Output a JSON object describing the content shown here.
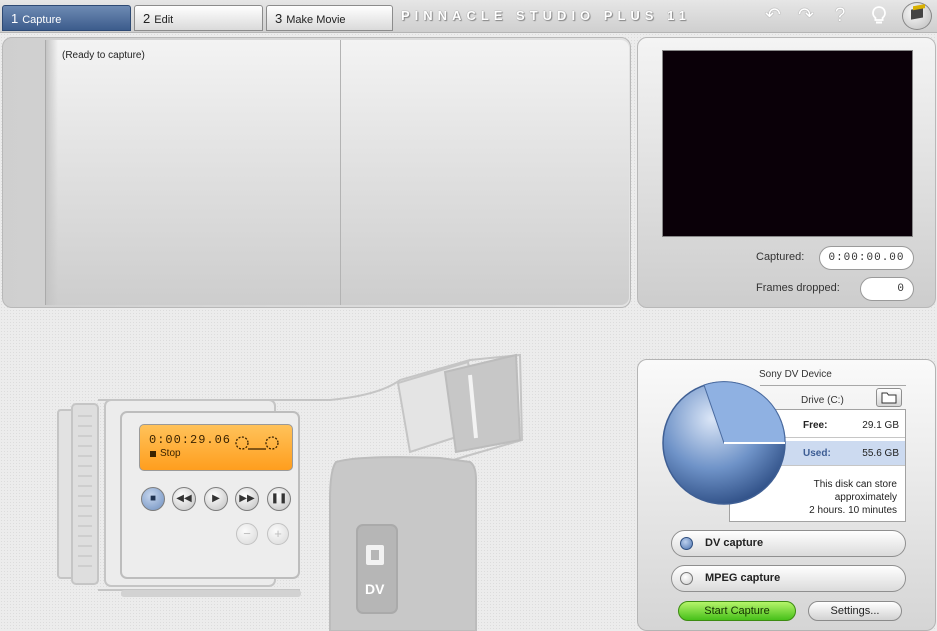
{
  "app": {
    "title": "PINNACLE STUDIO PLUS 11"
  },
  "tabs": [
    {
      "number": "1",
      "label": "Capture",
      "active": true
    },
    {
      "number": "2",
      "label": "Edit",
      "active": false
    },
    {
      "number": "3",
      "label": "Make Movie",
      "active": false
    }
  ],
  "toolbar_icons": [
    "undo-icon",
    "redo-icon",
    "help-icon",
    "hint-icon",
    "studio-icon"
  ],
  "album": {
    "status": "(Ready to capture)"
  },
  "player": {
    "captured_label": "Captured:",
    "captured_value": "0:00:00.00",
    "frames_dropped_label": "Frames dropped:",
    "frames_dropped_value": "0"
  },
  "camcorder": {
    "timecode": "0:00:29.06",
    "status": "Stop",
    "badge": "DV",
    "controls": [
      "stop-icon",
      "rewind-icon",
      "play-icon",
      "fast-forward-icon",
      "pause-icon",
      "minus-icon",
      "plus-icon"
    ]
  },
  "capture": {
    "device": "Sony DV Device",
    "drive": "Drive (C:)",
    "free_label": "Free:",
    "free_value": "29.1 GB",
    "used_label": "Used:",
    "used_value": "55.6 GB",
    "note_line1": "This disk can store",
    "note_line2": "approximately",
    "note_line3": "2 hours. 10 minutes",
    "formats": [
      {
        "label": "DV capture",
        "selected": true
      },
      {
        "label": "MPEG capture",
        "selected": false
      }
    ],
    "start_label": "Start Capture",
    "settings_label": "Settings..."
  },
  "colors": {
    "active_tab": "#3c5c8c",
    "lcd": "#ff9e1e",
    "start_button": "#47c01a",
    "disk_pie": "#4d74b0"
  }
}
